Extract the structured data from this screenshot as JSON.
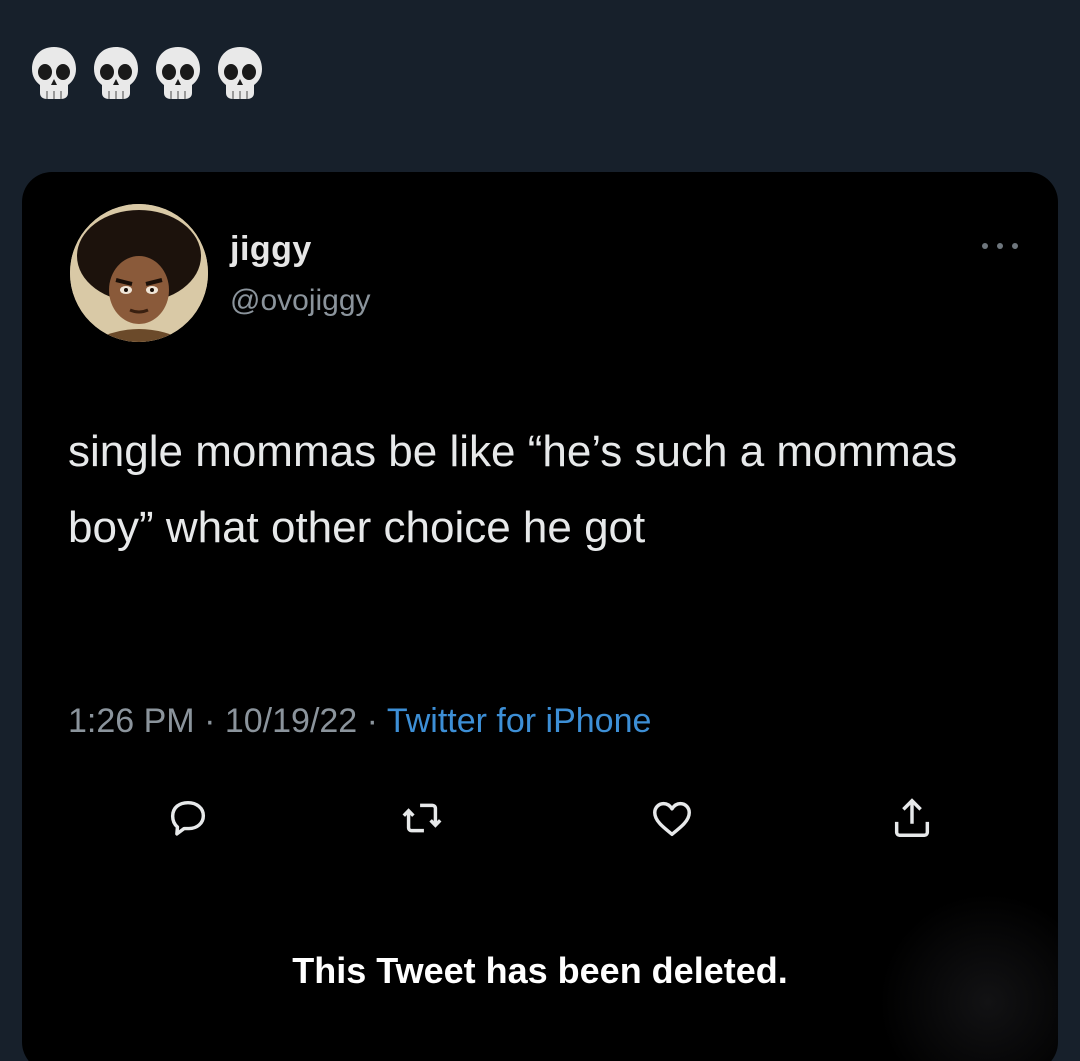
{
  "header": {
    "emojis": [
      "skull-icon",
      "skull-icon",
      "skull-icon",
      "skull-icon"
    ]
  },
  "tweet": {
    "display_name": "jiggy",
    "handle": "@ovojiggy",
    "text": "single mommas be like “he’s such a mommas boy” what other choice he got",
    "time": "1:26 PM",
    "separator": "·",
    "date": "10/19/22",
    "source": "Twitter for iPhone",
    "actions": [
      "reply-icon",
      "retweet-icon",
      "like-icon",
      "share-icon"
    ],
    "deleted_notice": "This Tweet has been deleted."
  },
  "colors": {
    "background": "#17202b",
    "card": "#000000",
    "link": "#3d8fd6",
    "muted": "#8b949c"
  }
}
